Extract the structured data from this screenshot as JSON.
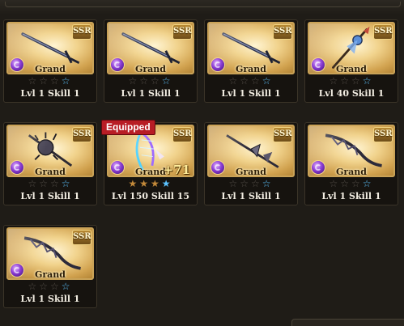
{
  "cards": [
    {
      "rarity": "SSR",
      "type_label": "Grand",
      "weapon_icon": "sword-icon",
      "level_label": "Lvl 1 Skill 1",
      "stars": [
        "gray",
        "gray",
        "gray",
        "blue"
      ],
      "equipped": false
    },
    {
      "rarity": "SSR",
      "type_label": "Grand",
      "weapon_icon": "sword-icon",
      "level_label": "Lvl 1 Skill 1",
      "stars": [
        "gray",
        "gray",
        "gray",
        "blue"
      ],
      "equipped": false
    },
    {
      "rarity": "SSR",
      "type_label": "Grand",
      "weapon_icon": "sword-icon",
      "level_label": "Lvl 1 Skill 1",
      "stars": [
        "gray",
        "gray",
        "gray",
        "blue"
      ],
      "equipped": false
    },
    {
      "rarity": "SSR",
      "type_label": "Grand",
      "weapon_icon": "staff-icon",
      "level_label": "Lvl 40 Skill 1",
      "stars": [
        "gray",
        "gray",
        "gray",
        "blue"
      ],
      "equipped": false
    },
    {
      "rarity": "SSR",
      "type_label": "Grand",
      "weapon_icon": "mace-icon",
      "level_label": "Lvl 1 Skill 1",
      "stars": [
        "gray",
        "gray",
        "gray",
        "blue"
      ],
      "equipped": false
    },
    {
      "rarity": "SSR",
      "type_label": "Grand",
      "weapon_icon": "harp-icon",
      "level_label": "Lvl 150 Skill 15",
      "stars": [
        "gold",
        "gold",
        "gold",
        "blue"
      ],
      "equipped": true,
      "equipped_label": "Equipped",
      "plus_label": "+71"
    },
    {
      "rarity": "SSR",
      "type_label": "Grand",
      "weapon_icon": "spear-icon",
      "level_label": "Lvl 1 Skill 1",
      "stars": [
        "gray",
        "gray",
        "gray",
        "blue"
      ],
      "equipped": false
    },
    {
      "rarity": "SSR",
      "type_label": "Grand",
      "weapon_icon": "scythe-icon",
      "level_label": "Lvl 1 Skill 1",
      "stars": [
        "gray",
        "gray",
        "gray",
        "blue"
      ],
      "equipped": false
    },
    {
      "rarity": "SSR",
      "type_label": "Grand",
      "weapon_icon": "scythe-icon",
      "level_label": "Lvl 1 Skill 1",
      "stars": [
        "gray",
        "gray",
        "gray",
        "blue"
      ],
      "equipped": false
    }
  ],
  "colors": {
    "frame": "#c9a257",
    "equipped_badge": "#b81d25",
    "star_blue": "#5cc3ff",
    "element": "#8a3cd4"
  }
}
